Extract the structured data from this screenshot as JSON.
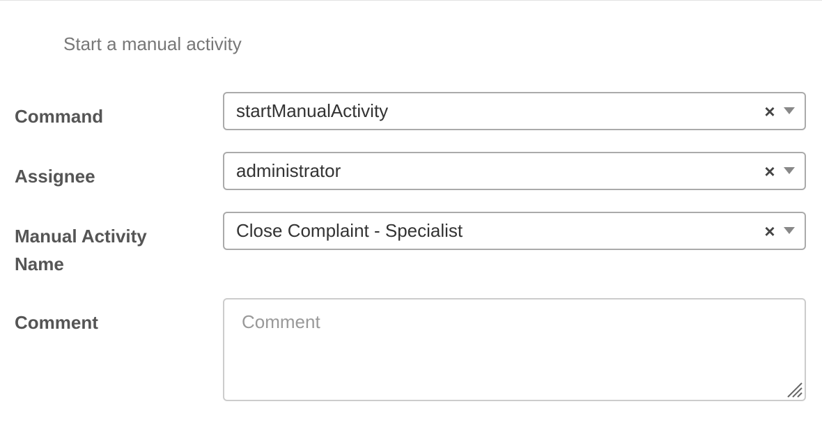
{
  "header": {
    "subtitle": "Start a manual activity"
  },
  "form": {
    "command": {
      "label": "Command",
      "value": "startManualActivity",
      "clear_glyph": "×"
    },
    "assignee": {
      "label": "Assignee",
      "value": "administrator",
      "clear_glyph": "×"
    },
    "manual_activity_name": {
      "label": "Manual Activity Name",
      "value": "Close Complaint - Specialist",
      "clear_glyph": "×"
    },
    "comment": {
      "label": "Comment",
      "placeholder": "Comment",
      "value": ""
    }
  },
  "icons": {
    "clear": "close-icon",
    "dropdown": "caret-down-icon",
    "resize": "resize-handle-icon"
  },
  "colors": {
    "label_text": "#555555",
    "value_text": "#333333",
    "subtitle_text": "#777777",
    "border": "#aaaaaa",
    "placeholder_text": "#999999"
  }
}
